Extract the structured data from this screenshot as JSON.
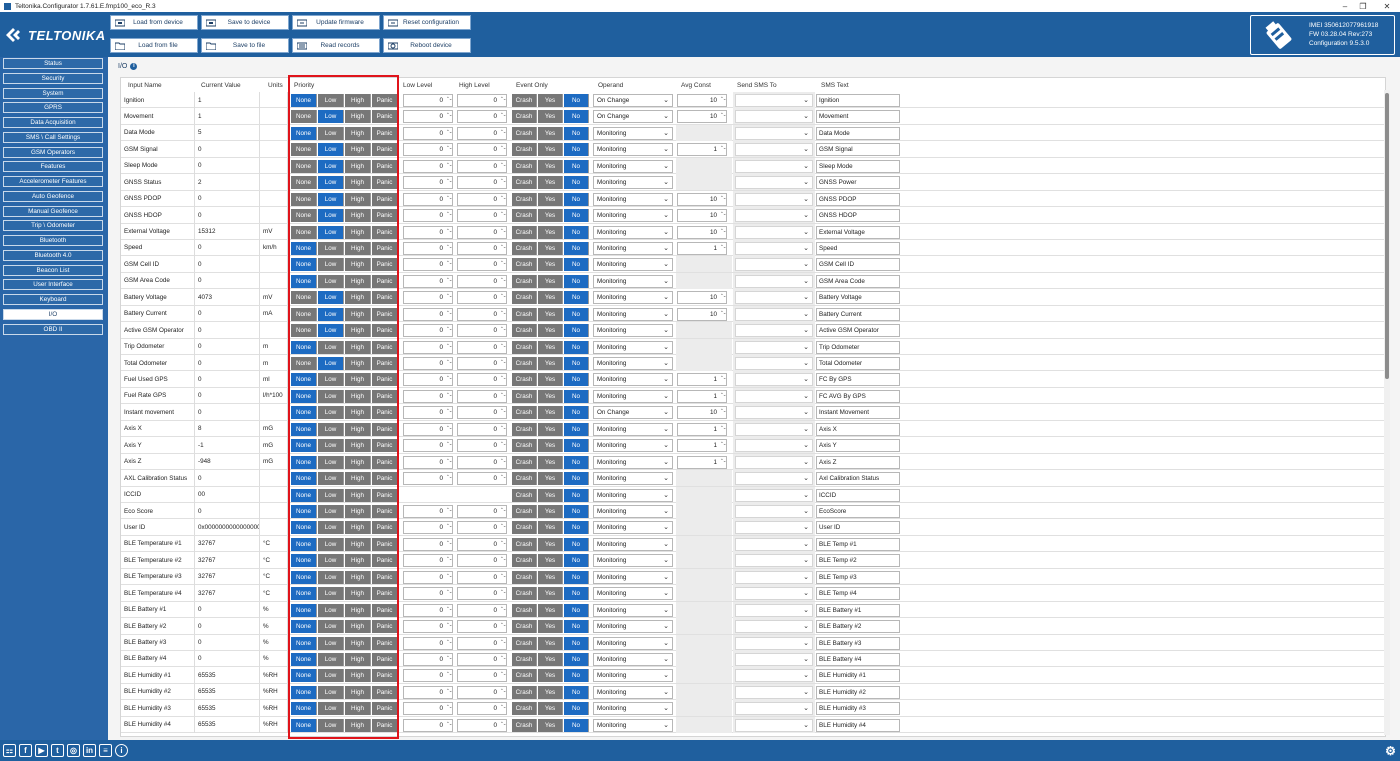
{
  "window": {
    "title": "Teltonika.Configurator 1.7.61.E.fmp100_eco_R.3"
  },
  "brand": {
    "logo_text": "TELTONIKA"
  },
  "toolbar": {
    "load_from_device": "Load from device",
    "save_to_device": "Save to device",
    "update_firmware": "Update firmware",
    "reset_configuration": "Reset configuration",
    "load_from_file": "Load from file",
    "save_to_file": "Save to file",
    "read_records": "Read records",
    "reboot_device": "Reboot device"
  },
  "device": {
    "imei": "IMEI 350612077961918",
    "fw": "FW 03.28.04 Rev:273",
    "configuration": "Configuration 9.5.3.0"
  },
  "sidebar": {
    "items": [
      "Status",
      "Security",
      "System",
      "GPRS",
      "Data Acquisition",
      "SMS \\ Call Settings",
      "GSM Operators",
      "Features",
      "Accelerometer Features",
      "Auto Geofence",
      "Manual Geofence",
      "Trip \\ Odometer",
      "Bluetooth",
      "Bluetooth 4.0",
      "Beacon List",
      "User Interface",
      "Keyboard",
      "I/O",
      "OBD II"
    ],
    "active": "I/O"
  },
  "section": {
    "title": "I/O"
  },
  "columns": {
    "name": "Input Name",
    "current": "Current Value",
    "units": "Units",
    "priority": "Priority",
    "low": "Low Level",
    "high": "High Level",
    "event": "Event Only",
    "operand": "Operand",
    "avg": "Avg Const",
    "smsto": "Send SMS To",
    "smstext": "SMS Text"
  },
  "labels": {
    "priority": [
      "None",
      "Low",
      "High",
      "Panic"
    ],
    "event": [
      "Crash",
      "Yes",
      "No"
    ]
  },
  "rows": [
    {
      "name": "Ignition",
      "value": "1",
      "unit": "",
      "prio": "None",
      "low": "0",
      "high": "0",
      "operand": "On Change",
      "avg": "10",
      "sms": "Ignition"
    },
    {
      "name": "Movement",
      "value": "1",
      "unit": "",
      "prio": "Low",
      "low": "0",
      "high": "0",
      "operand": "On Change",
      "avg": "10",
      "sms": "Movement"
    },
    {
      "name": "Data Mode",
      "value": "5",
      "unit": "",
      "prio": "None",
      "low": "0",
      "high": "0",
      "operand": "Monitoring",
      "avg": "",
      "sms": "Data Mode"
    },
    {
      "name": "GSM Signal",
      "value": "0",
      "unit": "",
      "prio": "Low",
      "low": "0",
      "high": "0",
      "operand": "Monitoring",
      "avg": "1",
      "sms": "GSM Signal"
    },
    {
      "name": "Sleep Mode",
      "value": "0",
      "unit": "",
      "prio": "Low",
      "low": "0",
      "high": "0",
      "operand": "Monitoring",
      "avg": "",
      "sms": "Sleep Mode"
    },
    {
      "name": "GNSS Status",
      "value": "2",
      "unit": "",
      "prio": "Low",
      "low": "0",
      "high": "0",
      "operand": "Monitoring",
      "avg": "",
      "sms": "GNSS Power"
    },
    {
      "name": "GNSS PDOP",
      "value": "0",
      "unit": "",
      "prio": "Low",
      "low": "0",
      "high": "0",
      "operand": "Monitoring",
      "avg": "10",
      "sms": "GNSS PDOP"
    },
    {
      "name": "GNSS HDOP",
      "value": "0",
      "unit": "",
      "prio": "Low",
      "low": "0",
      "high": "0",
      "operand": "Monitoring",
      "avg": "10",
      "sms": "GNSS HDOP"
    },
    {
      "name": "External Voltage",
      "value": "15312",
      "unit": "mV",
      "prio": "Low",
      "low": "0",
      "high": "0",
      "operand": "Monitoring",
      "avg": "10",
      "sms": "External Voltage"
    },
    {
      "name": "Speed",
      "value": "0",
      "unit": "km/h",
      "prio": "None",
      "low": "0",
      "high": "0",
      "operand": "Monitoring",
      "avg": "1",
      "sms": "Speed"
    },
    {
      "name": "GSM Cell ID",
      "value": "0",
      "unit": "",
      "prio": "None",
      "low": "0",
      "high": "0",
      "operand": "Monitoring",
      "avg": "",
      "sms": "GSM Cell ID"
    },
    {
      "name": "GSM Area Code",
      "value": "0",
      "unit": "",
      "prio": "None",
      "low": "0",
      "high": "0",
      "operand": "Monitoring",
      "avg": "",
      "sms": "GSM Area Code"
    },
    {
      "name": "Battery Voltage",
      "value": "4073",
      "unit": "mV",
      "prio": "Low",
      "low": "0",
      "high": "0",
      "operand": "Monitoring",
      "avg": "10",
      "sms": "Battery Voltage"
    },
    {
      "name": "Battery Current",
      "value": "0",
      "unit": "mA",
      "prio": "Low",
      "low": "0",
      "high": "0",
      "operand": "Monitoring",
      "avg": "10",
      "sms": "Battery Current"
    },
    {
      "name": "Active GSM Operator",
      "value": "0",
      "unit": "",
      "prio": "Low",
      "low": "0",
      "high": "0",
      "operand": "Monitoring",
      "avg": "",
      "sms": "Active GSM Operator"
    },
    {
      "name": "Trip Odometer",
      "value": "0",
      "unit": "m",
      "prio": "None",
      "low": "0",
      "high": "0",
      "operand": "Monitoring",
      "avg": "",
      "sms": "Trip Odometer"
    },
    {
      "name": "Total Odometer",
      "value": "0",
      "unit": "m",
      "prio": "Low",
      "low": "0",
      "high": "0",
      "operand": "Monitoring",
      "avg": "",
      "sms": "Total Odometer"
    },
    {
      "name": "Fuel Used GPS",
      "value": "0",
      "unit": "ml",
      "prio": "None",
      "low": "0",
      "high": "0",
      "operand": "Monitoring",
      "avg": "1",
      "sms": "FC By GPS"
    },
    {
      "name": "Fuel Rate GPS",
      "value": "0",
      "unit": "l/h*100",
      "prio": "None",
      "low": "0",
      "high": "0",
      "operand": "Monitoring",
      "avg": "1",
      "sms": "FC AVG By GPS"
    },
    {
      "name": "Instant movement",
      "value": "0",
      "unit": "",
      "prio": "None",
      "low": "0",
      "high": "0",
      "operand": "On Change",
      "avg": "10",
      "sms": "Instant Movement"
    },
    {
      "name": "Axis X",
      "value": "8",
      "unit": "mG",
      "prio": "None",
      "low": "0",
      "high": "0",
      "operand": "Monitoring",
      "avg": "1",
      "sms": "Axis X"
    },
    {
      "name": "Axis Y",
      "value": "-1",
      "unit": "mG",
      "prio": "None",
      "low": "0",
      "high": "0",
      "operand": "Monitoring",
      "avg": "1",
      "sms": "Axis Y"
    },
    {
      "name": "Axis Z",
      "value": "-948",
      "unit": "mG",
      "prio": "None",
      "low": "0",
      "high": "0",
      "operand": "Monitoring",
      "avg": "1",
      "sms": "Axis Z"
    },
    {
      "name": "AXL Calibration Status",
      "value": "0",
      "unit": "",
      "prio": "None",
      "low": "0",
      "high": "0",
      "operand": "Monitoring",
      "avg": "",
      "sms": "Axl Calibration Status"
    },
    {
      "name": "ICCID",
      "value": "00",
      "unit": "",
      "prio": "None",
      "low": "",
      "high": "",
      "operand": "Monitoring",
      "avg": "",
      "sms": "ICCID"
    },
    {
      "name": "Eco Score",
      "value": "0",
      "unit": "",
      "prio": "None",
      "low": "0",
      "high": "0",
      "operand": "Monitoring",
      "avg": "",
      "sms": "EcoScore"
    },
    {
      "name": "User ID",
      "value": "0x0000000000000000",
      "unit": "",
      "prio": "None",
      "low": "0",
      "high": "0",
      "operand": "Monitoring",
      "avg": "",
      "sms": "User ID"
    },
    {
      "name": "BLE Temperature #1",
      "value": "32767",
      "unit": "°C",
      "prio": "None",
      "low": "0",
      "high": "0",
      "operand": "Monitoring",
      "avg": "",
      "sms": "BLE Temp #1"
    },
    {
      "name": "BLE Temperature #2",
      "value": "32767",
      "unit": "°C",
      "prio": "None",
      "low": "0",
      "high": "0",
      "operand": "Monitoring",
      "avg": "",
      "sms": "BLE Temp #2"
    },
    {
      "name": "BLE Temperature #3",
      "value": "32767",
      "unit": "°C",
      "prio": "None",
      "low": "0",
      "high": "0",
      "operand": "Monitoring",
      "avg": "",
      "sms": "BLE Temp #3"
    },
    {
      "name": "BLE Temperature #4",
      "value": "32767",
      "unit": "°C",
      "prio": "None",
      "low": "0",
      "high": "0",
      "operand": "Monitoring",
      "avg": "",
      "sms": "BLE Temp #4"
    },
    {
      "name": "BLE Battery #1",
      "value": "0",
      "unit": "%",
      "prio": "None",
      "low": "0",
      "high": "0",
      "operand": "Monitoring",
      "avg": "",
      "sms": "BLE Battery #1"
    },
    {
      "name": "BLE Battery #2",
      "value": "0",
      "unit": "%",
      "prio": "None",
      "low": "0",
      "high": "0",
      "operand": "Monitoring",
      "avg": "",
      "sms": "BLE Battery #2"
    },
    {
      "name": "BLE Battery #3",
      "value": "0",
      "unit": "%",
      "prio": "None",
      "low": "0",
      "high": "0",
      "operand": "Monitoring",
      "avg": "",
      "sms": "BLE Battery #3"
    },
    {
      "name": "BLE Battery #4",
      "value": "0",
      "unit": "%",
      "prio": "None",
      "low": "0",
      "high": "0",
      "operand": "Monitoring",
      "avg": "",
      "sms": "BLE Battery #4"
    },
    {
      "name": "BLE Humidity #1",
      "value": "65535",
      "unit": "%RH",
      "prio": "None",
      "low": "0",
      "high": "0",
      "operand": "Monitoring",
      "avg": "",
      "sms": "BLE Humidity #1"
    },
    {
      "name": "BLE Humidity #2",
      "value": "65535",
      "unit": "%RH",
      "prio": "None",
      "low": "0",
      "high": "0",
      "operand": "Monitoring",
      "avg": "",
      "sms": "BLE Humidity #2"
    },
    {
      "name": "BLE Humidity #3",
      "value": "65535",
      "unit": "%RH",
      "prio": "None",
      "low": "0",
      "high": "0",
      "operand": "Monitoring",
      "avg": "",
      "sms": "BLE Humidity #3"
    },
    {
      "name": "BLE Humidity #4",
      "value": "65535",
      "unit": "%RH",
      "prio": "None",
      "low": "0",
      "high": "0",
      "operand": "Monitoring",
      "avg": "",
      "sms": "BLE Humidity #4"
    }
  ],
  "footer": {
    "icons": [
      "website-icon",
      "facebook-icon",
      "youtube-icon",
      "twitter-icon",
      "instagram-icon",
      "linkedin-icon",
      "wiki-icon",
      "info-icon",
      "settings-icon"
    ]
  },
  "colors": {
    "brand_blue": "#1f5f9e",
    "active_blue": "#1d6bc2",
    "inactive_gray": "#777777",
    "highlight_red": "#e0141b"
  }
}
